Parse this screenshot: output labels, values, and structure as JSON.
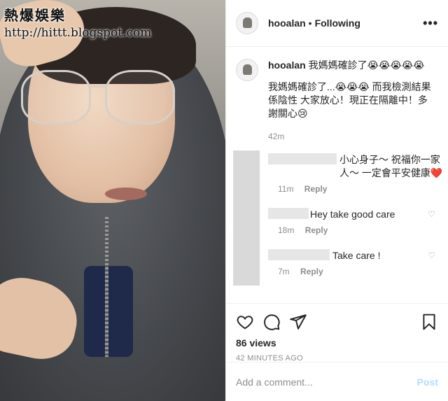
{
  "watermark": {
    "title": "熱爆娛樂",
    "url": "http://hittt.blogspot.com"
  },
  "header": {
    "username": "hooalan",
    "separator": "•",
    "follow_status": "Following",
    "more_icon": "more-horizontal-icon"
  },
  "caption": {
    "username": "hooalan",
    "title_text": "我媽媽確診了😭😭😭😭😭",
    "body_text": "我媽媽確診了...😭😭😭 而我檢測結果係陰性 大家放心！現正在隔離中！多謝關心😢",
    "time": "42m"
  },
  "comments": [
    {
      "text": "小心身子～ 祝福你一家人～ 一定會平安健康❤️",
      "time": "11m",
      "reply": "Reply"
    },
    {
      "text": "Hey take good care",
      "time": "18m",
      "reply": "Reply"
    },
    {
      "text": "Take care !",
      "time": "7m",
      "reply": "Reply"
    }
  ],
  "actions": {
    "views": "86 views",
    "posted": "42 MINUTES AGO",
    "icons": [
      "heart-icon",
      "comment-icon",
      "share-icon",
      "bookmark-icon"
    ]
  },
  "add_comment": {
    "placeholder": "Add a comment...",
    "post_label": "Post"
  },
  "colors": {
    "link_disabled": "#b3dbff",
    "muted": "#8e8e8e",
    "text": "#262626"
  }
}
